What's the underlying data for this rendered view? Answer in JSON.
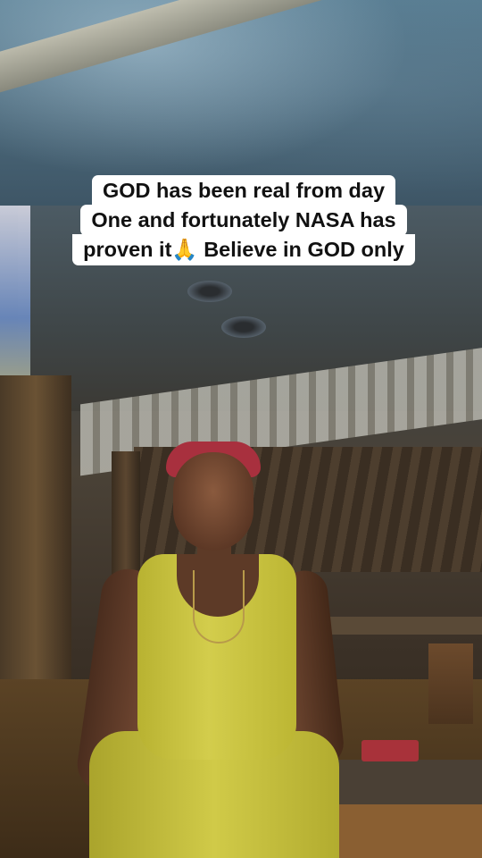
{
  "caption": {
    "line1": "GOD has been real from day",
    "line2": "One and fortunately NASA  has",
    "line3": "proven it🙏 Believe in GOD only"
  },
  "photo": {
    "subject": "woman in yellow sleeveless dress with red headband",
    "setting": "covered outdoor wooden shed at night"
  },
  "colors": {
    "caption_bg": "#ffffff",
    "caption_text": "#111111",
    "dress": "#cfc946",
    "headband": "#a8303e"
  }
}
